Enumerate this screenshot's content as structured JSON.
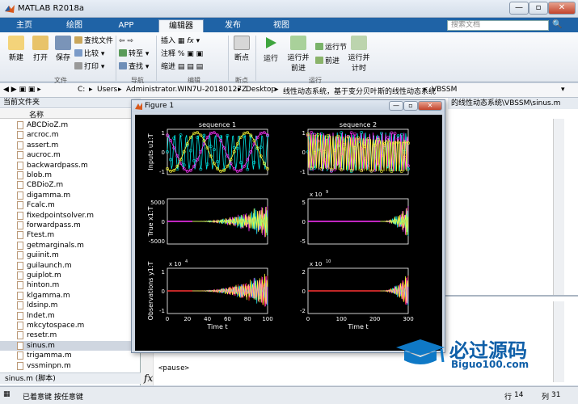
{
  "window": {
    "title": "MATLAB R2018a"
  },
  "tabs": [
    "主页",
    "绘图",
    "APP",
    "编辑器",
    "发布",
    "视图"
  ],
  "search": {
    "placeholder": "搜索文档"
  },
  "ribbon": {
    "file": {
      "new": "新建",
      "open": "打开",
      "save": "保存",
      "find_files": "查找文件",
      "compare": "比较",
      "print": "打印",
      "group": "文件"
    },
    "nav": {
      "find": "查找",
      "goto": "转至",
      "group": "导航"
    },
    "edit": {
      "insert": "插入",
      "comment": "注释",
      "indent": "缩进",
      "group": "编辑"
    },
    "breakpoints": {
      "label": "断点",
      "group": "断点"
    },
    "run": {
      "run": "运行",
      "run_advance": "运行并\n前进",
      "run_section": "运行节",
      "advance": "前进",
      "run_time": "运行并\n计时",
      "group": "运行"
    }
  },
  "address": [
    "C:",
    "Users",
    "Administrator.WIN7U-20180127Z",
    "Desktop",
    "线性动态系统，基于变分贝叶斯的线性动态系统",
    "VBSSM"
  ],
  "address_tail": "的线性动态系统\\VBSSM\\sinus.m",
  "left_panel": {
    "title": "当前文件夹",
    "col_name": "名称",
    "files": [
      "ABCDioZ.m",
      "arcroc.m",
      "assert.m",
      "aucroc.m",
      "backwardpass.m",
      "blob.m",
      "CBDioZ.m",
      "digamma.m",
      "Fcalc.m",
      "fixedpointsolver.m",
      "forwardpass.m",
      "Ftest.m",
      "getmarginals.m",
      "guiinit.m",
      "guilaunch.m",
      "guiplot.m",
      "hinton.m",
      "klgamma.m",
      "ldsinp.m",
      "lndet.m",
      "mkcytospace.m",
      "resetr.m",
      "sinus.m",
      "trigamma.m",
      "vssminpn.m"
    ],
    "selected": "sinus.m",
    "footer": "sinus.m  (脚本)"
  },
  "command": {
    "text": "<pause>",
    "fx": "fx"
  },
  "status": {
    "left": "已着意键  按任意键",
    "ln": "行",
    "col": "列",
    "ln_v": "14",
    "col_v": "31"
  },
  "figure": {
    "title": "Figure 1",
    "plots": [
      {
        "title": "sequence 1",
        "ylabel": "Inputs u1:T",
        "yticks": [
          "1",
          "0",
          "-1"
        ],
        "xticks": []
      },
      {
        "title": "sequence 2",
        "ylabel": "",
        "yticks": [
          "1",
          "0",
          "-1"
        ],
        "xticks": []
      },
      {
        "title": "",
        "ylabel": "True x1:T",
        "yticks": [
          "5000",
          "0",
          "-5000"
        ],
        "xticks": []
      },
      {
        "title": "",
        "ylabel": "",
        "exp": "x 10",
        "expn": "9",
        "yticks": [
          "5",
          "0",
          "-5"
        ],
        "xticks": []
      },
      {
        "title": "",
        "ylabel": "Observations y1:T",
        "exp": "x 10",
        "expn": "4",
        "yticks": [
          "1",
          "0",
          "-1"
        ],
        "xticks": [
          "0",
          "20",
          "40",
          "60",
          "80",
          "100"
        ],
        "xlabel": "Time t"
      },
      {
        "title": "",
        "ylabel": "",
        "exp": "x 10",
        "expn": "10",
        "yticks": [
          "2",
          "0",
          "-2"
        ],
        "xticks": [
          "0",
          "100",
          "200",
          "300"
        ],
        "xlabel": "Time t"
      }
    ]
  },
  "watermark": {
    "cn": "必过源码",
    "en": "Biguo100.com"
  }
}
